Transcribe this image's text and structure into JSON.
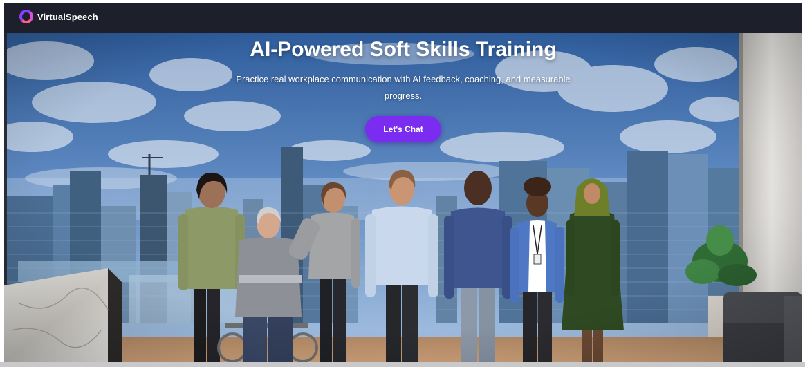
{
  "nav": {
    "logo_text": "VirtualSpeech",
    "logo_icon": "virtualspeech-logo-ring-icon"
  },
  "hero": {
    "title": "AI-Powered Soft Skills Training",
    "subtitle": "Practice real workplace communication with AI feedback, coaching, and measurable progress.",
    "cta_label": "Let's Chat",
    "scene_image": "office-window-city-skyline-with-seven-avatars"
  },
  "colors": {
    "nav_bg": "#1d1f2a",
    "cta_bg": "#7a2cf0",
    "logo_gradient": [
      "#8b3dff",
      "#e04fd0",
      "#ff5f8a"
    ],
    "sky": "#6d93c9",
    "text": "#ffffff"
  }
}
